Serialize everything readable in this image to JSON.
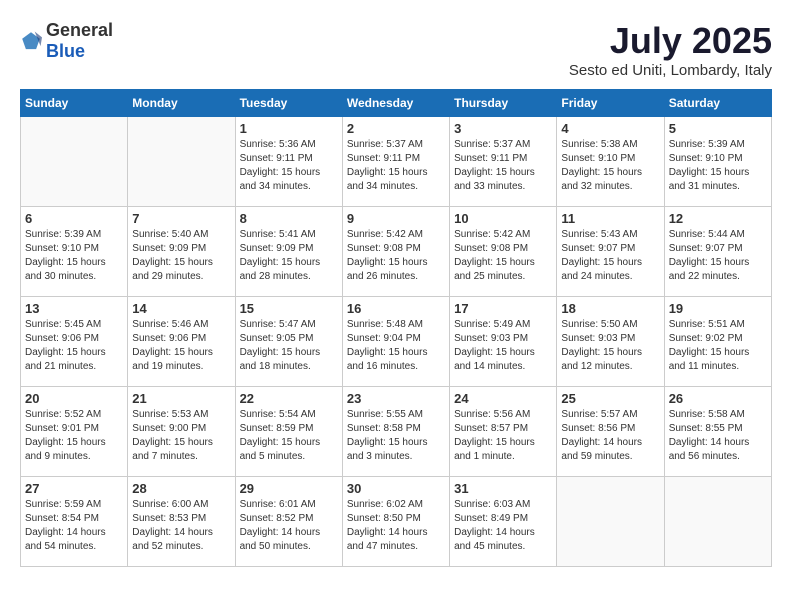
{
  "header": {
    "logo": {
      "general": "General",
      "blue": "Blue"
    },
    "title": "July 2025",
    "location": "Sesto ed Uniti, Lombardy, Italy"
  },
  "calendar": {
    "weekdays": [
      "Sunday",
      "Monday",
      "Tuesday",
      "Wednesday",
      "Thursday",
      "Friday",
      "Saturday"
    ],
    "weeks": [
      [
        {
          "day": "",
          "content": ""
        },
        {
          "day": "",
          "content": ""
        },
        {
          "day": "1",
          "content": "Sunrise: 5:36 AM\nSunset: 9:11 PM\nDaylight: 15 hours\nand 34 minutes."
        },
        {
          "day": "2",
          "content": "Sunrise: 5:37 AM\nSunset: 9:11 PM\nDaylight: 15 hours\nand 34 minutes."
        },
        {
          "day": "3",
          "content": "Sunrise: 5:37 AM\nSunset: 9:11 PM\nDaylight: 15 hours\nand 33 minutes."
        },
        {
          "day": "4",
          "content": "Sunrise: 5:38 AM\nSunset: 9:10 PM\nDaylight: 15 hours\nand 32 minutes."
        },
        {
          "day": "5",
          "content": "Sunrise: 5:39 AM\nSunset: 9:10 PM\nDaylight: 15 hours\nand 31 minutes."
        }
      ],
      [
        {
          "day": "6",
          "content": "Sunrise: 5:39 AM\nSunset: 9:10 PM\nDaylight: 15 hours\nand 30 minutes."
        },
        {
          "day": "7",
          "content": "Sunrise: 5:40 AM\nSunset: 9:09 PM\nDaylight: 15 hours\nand 29 minutes."
        },
        {
          "day": "8",
          "content": "Sunrise: 5:41 AM\nSunset: 9:09 PM\nDaylight: 15 hours\nand 28 minutes."
        },
        {
          "day": "9",
          "content": "Sunrise: 5:42 AM\nSunset: 9:08 PM\nDaylight: 15 hours\nand 26 minutes."
        },
        {
          "day": "10",
          "content": "Sunrise: 5:42 AM\nSunset: 9:08 PM\nDaylight: 15 hours\nand 25 minutes."
        },
        {
          "day": "11",
          "content": "Sunrise: 5:43 AM\nSunset: 9:07 PM\nDaylight: 15 hours\nand 24 minutes."
        },
        {
          "day": "12",
          "content": "Sunrise: 5:44 AM\nSunset: 9:07 PM\nDaylight: 15 hours\nand 22 minutes."
        }
      ],
      [
        {
          "day": "13",
          "content": "Sunrise: 5:45 AM\nSunset: 9:06 PM\nDaylight: 15 hours\nand 21 minutes."
        },
        {
          "day": "14",
          "content": "Sunrise: 5:46 AM\nSunset: 9:06 PM\nDaylight: 15 hours\nand 19 minutes."
        },
        {
          "day": "15",
          "content": "Sunrise: 5:47 AM\nSunset: 9:05 PM\nDaylight: 15 hours\nand 18 minutes."
        },
        {
          "day": "16",
          "content": "Sunrise: 5:48 AM\nSunset: 9:04 PM\nDaylight: 15 hours\nand 16 minutes."
        },
        {
          "day": "17",
          "content": "Sunrise: 5:49 AM\nSunset: 9:03 PM\nDaylight: 15 hours\nand 14 minutes."
        },
        {
          "day": "18",
          "content": "Sunrise: 5:50 AM\nSunset: 9:03 PM\nDaylight: 15 hours\nand 12 minutes."
        },
        {
          "day": "19",
          "content": "Sunrise: 5:51 AM\nSunset: 9:02 PM\nDaylight: 15 hours\nand 11 minutes."
        }
      ],
      [
        {
          "day": "20",
          "content": "Sunrise: 5:52 AM\nSunset: 9:01 PM\nDaylight: 15 hours\nand 9 minutes."
        },
        {
          "day": "21",
          "content": "Sunrise: 5:53 AM\nSunset: 9:00 PM\nDaylight: 15 hours\nand 7 minutes."
        },
        {
          "day": "22",
          "content": "Sunrise: 5:54 AM\nSunset: 8:59 PM\nDaylight: 15 hours\nand 5 minutes."
        },
        {
          "day": "23",
          "content": "Sunrise: 5:55 AM\nSunset: 8:58 PM\nDaylight: 15 hours\nand 3 minutes."
        },
        {
          "day": "24",
          "content": "Sunrise: 5:56 AM\nSunset: 8:57 PM\nDaylight: 15 hours\nand 1 minute."
        },
        {
          "day": "25",
          "content": "Sunrise: 5:57 AM\nSunset: 8:56 PM\nDaylight: 14 hours\nand 59 minutes."
        },
        {
          "day": "26",
          "content": "Sunrise: 5:58 AM\nSunset: 8:55 PM\nDaylight: 14 hours\nand 56 minutes."
        }
      ],
      [
        {
          "day": "27",
          "content": "Sunrise: 5:59 AM\nSunset: 8:54 PM\nDaylight: 14 hours\nand 54 minutes."
        },
        {
          "day": "28",
          "content": "Sunrise: 6:00 AM\nSunset: 8:53 PM\nDaylight: 14 hours\nand 52 minutes."
        },
        {
          "day": "29",
          "content": "Sunrise: 6:01 AM\nSunset: 8:52 PM\nDaylight: 14 hours\nand 50 minutes."
        },
        {
          "day": "30",
          "content": "Sunrise: 6:02 AM\nSunset: 8:50 PM\nDaylight: 14 hours\nand 47 minutes."
        },
        {
          "day": "31",
          "content": "Sunrise: 6:03 AM\nSunset: 8:49 PM\nDaylight: 14 hours\nand 45 minutes."
        },
        {
          "day": "",
          "content": ""
        },
        {
          "day": "",
          "content": ""
        }
      ]
    ]
  }
}
